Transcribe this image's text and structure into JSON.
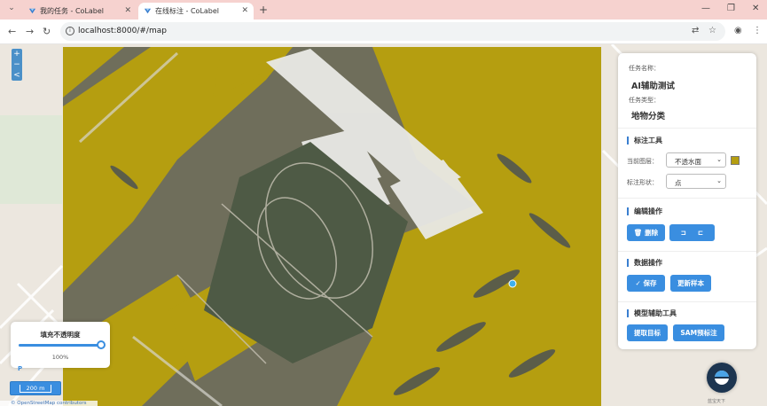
{
  "browser": {
    "tabs": [
      {
        "title": "我的任务 - CoLabel",
        "active": false
      },
      {
        "title": "在线标注 - CoLabel",
        "active": true
      }
    ],
    "new_tab": "+",
    "url": "localhost:8000/#/map",
    "window_controls": [
      "—",
      "❐",
      "✕"
    ]
  },
  "map": {
    "zoom_in": "+",
    "zoom_out": "−",
    "zoom_extra": "<",
    "scale": "200 m",
    "attribution": "© OpenStreetMap contributors",
    "overlay_color": "#b59e10",
    "marker_color": "#3fb0ee",
    "hint_letter": "P"
  },
  "panel": {
    "task_name_label": "任务名称：",
    "task_name": "AI辅助测试",
    "task_type_label": "任务类型：",
    "task_type": "地物分类",
    "annotation_tools": {
      "title": "标注工具",
      "layer_label": "当前图层：",
      "layer_value": "不透水面",
      "layer_color": "#b59e10",
      "shape_label": "标注形状：",
      "shape_value": "点"
    },
    "edit_ops": {
      "title": "编辑操作",
      "delete_label": "删除",
      "undo_label": "⊐",
      "redo_label": "⊏"
    },
    "data_ops": {
      "title": "数据操作",
      "save_label": "保存",
      "update_label": "更新样本"
    },
    "model_tools": {
      "title": "模型辅助工具",
      "extract_label": "提取目标",
      "sam_label": "SAM预标注"
    }
  },
  "opacity": {
    "title": "填充不透明度",
    "value_text": "100%",
    "value": 1.0
  },
  "fab": {
    "label": "蓝宝天下"
  }
}
